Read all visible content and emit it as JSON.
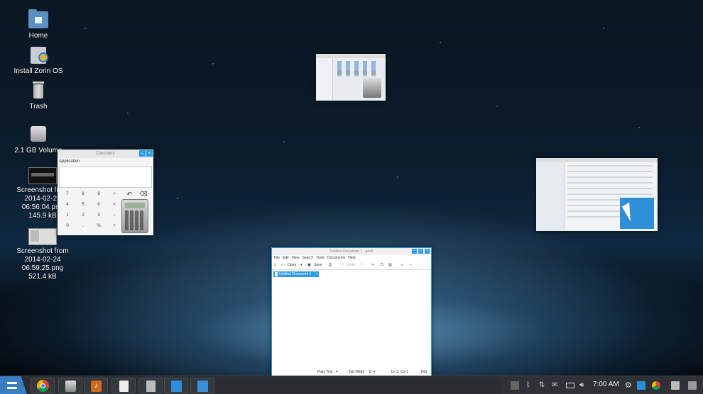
{
  "desktop": {
    "icons": [
      {
        "label": "Home"
      },
      {
        "label": "Install Zorin OS"
      },
      {
        "label": "Trash"
      },
      {
        "label": "2.1 GB Volume"
      },
      {
        "label": "Screenshot from 2014-02-24 06:56:04.png 145.9 kB"
      },
      {
        "label": "Screenshot from 2014-02-24 06:59:25.png 521.4 kB"
      }
    ]
  },
  "calculator": {
    "title": "Calculator",
    "menu": "Application",
    "keys": [
      "7",
      "8",
      "9",
      "÷",
      "4",
      "5",
      "6",
      "×",
      "1",
      "2",
      "3",
      "−",
      "0",
      ".",
      "%",
      "+"
    ]
  },
  "gedit": {
    "title": "Untitled Document 1 - gedit",
    "menu": [
      "File",
      "Edit",
      "View",
      "Search",
      "Tools",
      "Documents",
      "Help"
    ],
    "toolbar": {
      "open": "Open",
      "save": "Save",
      "undo": "Undo"
    },
    "tab": "Untitled Document 1",
    "status": {
      "lang": "Plain Text",
      "tabwidth": "Tab Width:",
      "tabwidth_val": "8",
      "position": "Ln 1, Col 1",
      "mode": "INS"
    }
  },
  "clock": "7:00 AM",
  "colors": {
    "accent": "#2d9be3",
    "taskbar": "#2a2d31"
  }
}
